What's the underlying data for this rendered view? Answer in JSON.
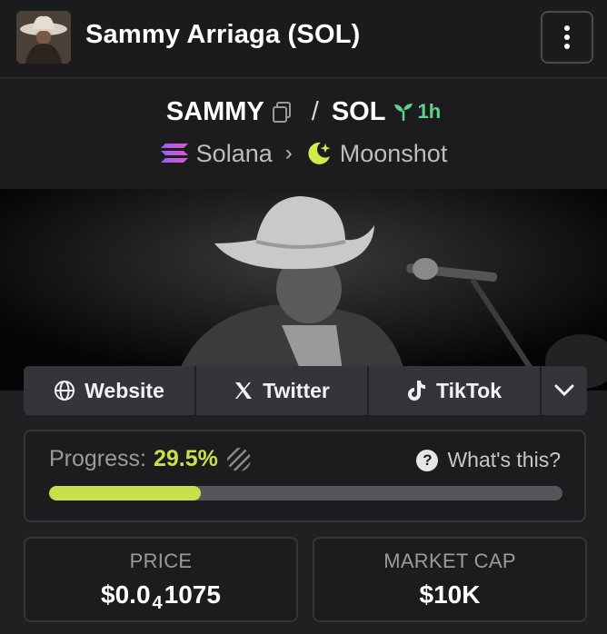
{
  "header": {
    "title": "Sammy Arriaga (SOL)",
    "avatar_icon": "cowboy-avatar",
    "menu_icon": "kebab-menu-icon"
  },
  "token": {
    "symbol": "SAMMY",
    "separator": "/",
    "quote": "SOL",
    "age": "1h",
    "chain": "Solana",
    "launchpad": "Moonshot"
  },
  "links": {
    "website": "Website",
    "twitter": "Twitter",
    "tiktok": "TikTok"
  },
  "progress": {
    "label": "Progress:",
    "value_text": "29.5%",
    "value": 0.295,
    "help": "What's this?",
    "accent": "#c6e14a"
  },
  "stats": {
    "price_label": "PRICE",
    "price_prefix": "$0.0",
    "price_zeros": "4",
    "price_rest": "1075",
    "mcap_label": "MARKET CAP",
    "mcap_value": "$10K"
  }
}
